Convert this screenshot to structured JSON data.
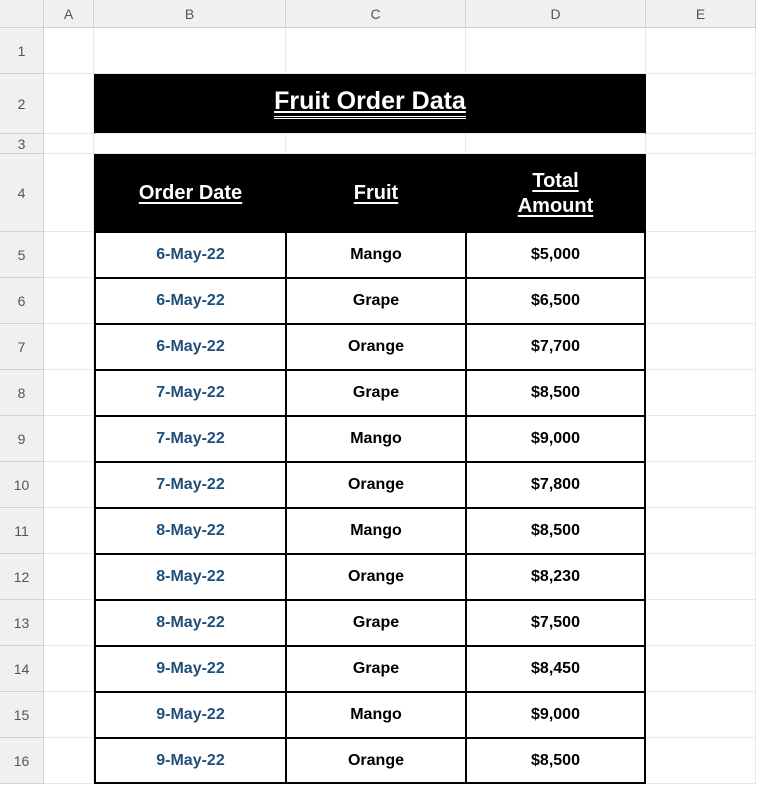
{
  "columns": [
    "A",
    "B",
    "C",
    "D",
    "E"
  ],
  "rowCount": 16,
  "title": "Fruit Order Data",
  "headers": {
    "b": "Order Date",
    "c": "Fruit",
    "d": "Total Amount"
  },
  "rows": [
    {
      "date": "6-May-22",
      "fruit": "Mango",
      "amount": "$5,000"
    },
    {
      "date": "6-May-22",
      "fruit": "Grape",
      "amount": "$6,500"
    },
    {
      "date": "6-May-22",
      "fruit": "Orange",
      "amount": "$7,700"
    },
    {
      "date": "7-May-22",
      "fruit": "Grape",
      "amount": "$8,500"
    },
    {
      "date": "7-May-22",
      "fruit": "Mango",
      "amount": "$9,000"
    },
    {
      "date": "7-May-22",
      "fruit": "Orange",
      "amount": "$7,800"
    },
    {
      "date": "8-May-22",
      "fruit": "Mango",
      "amount": "$8,500"
    },
    {
      "date": "8-May-22",
      "fruit": "Orange",
      "amount": "$8,230"
    },
    {
      "date": "8-May-22",
      "fruit": "Grape",
      "amount": "$7,500"
    },
    {
      "date": "9-May-22",
      "fruit": "Grape",
      "amount": "$8,450"
    },
    {
      "date": "9-May-22",
      "fruit": "Mango",
      "amount": "$9,000"
    },
    {
      "date": "9-May-22",
      "fruit": "Orange",
      "amount": "$8,500"
    }
  ],
  "chart_data": {
    "type": "table",
    "title": "Fruit Order Data",
    "columns": [
      "Order Date",
      "Fruit",
      "Total Amount"
    ],
    "rows": [
      [
        "6-May-22",
        "Mango",
        5000
      ],
      [
        "6-May-22",
        "Grape",
        6500
      ],
      [
        "6-May-22",
        "Orange",
        7700
      ],
      [
        "7-May-22",
        "Grape",
        8500
      ],
      [
        "7-May-22",
        "Mango",
        9000
      ],
      [
        "7-May-22",
        "Orange",
        7800
      ],
      [
        "8-May-22",
        "Mango",
        8500
      ],
      [
        "8-May-22",
        "Orange",
        8230
      ],
      [
        "8-May-22",
        "Grape",
        7500
      ],
      [
        "9-May-22",
        "Grape",
        8450
      ],
      [
        "9-May-22",
        "Mango",
        9000
      ],
      [
        "9-May-22",
        "Orange",
        8500
      ]
    ]
  }
}
